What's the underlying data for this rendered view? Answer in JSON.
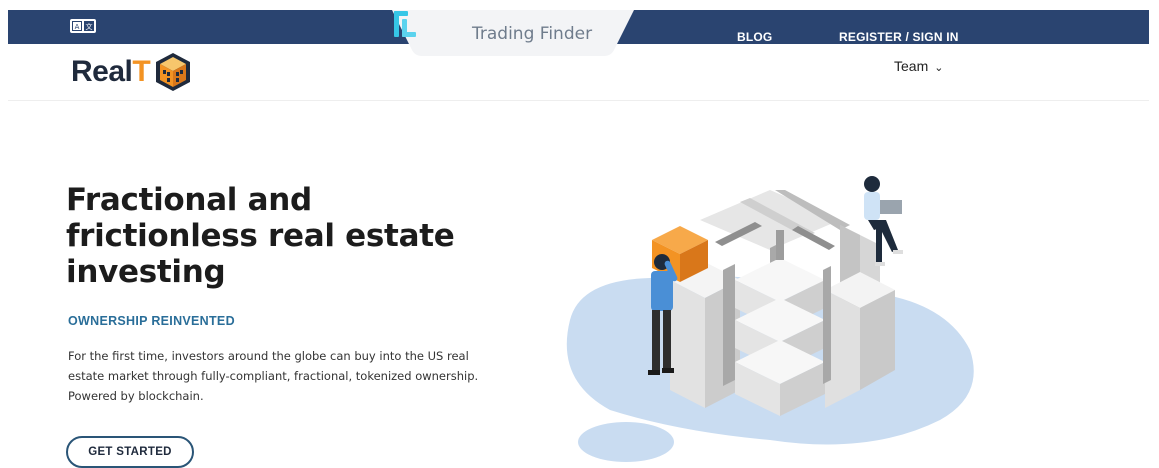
{
  "topbar": {
    "lang_icon": "language-switch-icon",
    "trading_finder_label": "Trading Finder",
    "blog_label": "BLOG",
    "register_label": "REGISTER / SIGN IN"
  },
  "header": {
    "logo_text_main": "Real",
    "logo_text_accent": "T",
    "logo_icon": "cube-house-icon",
    "team_label": "Team",
    "team_chevron": "⌄"
  },
  "hero": {
    "title": "Fractional and frictionless real estate investing",
    "eyebrow": "OWNERSHIP REINVENTED",
    "description": "For the first time, investors around the globe can buy into the US real estate market through fully-compliant, fractional, tokenized ownership. Powered by blockchain.",
    "cta_label": "GET STARTED"
  },
  "colors": {
    "topbar": "#2a4470",
    "accent_orange": "#f39323",
    "eyebrow_blue": "#2a6e99",
    "blob": "#c9dcf1"
  }
}
